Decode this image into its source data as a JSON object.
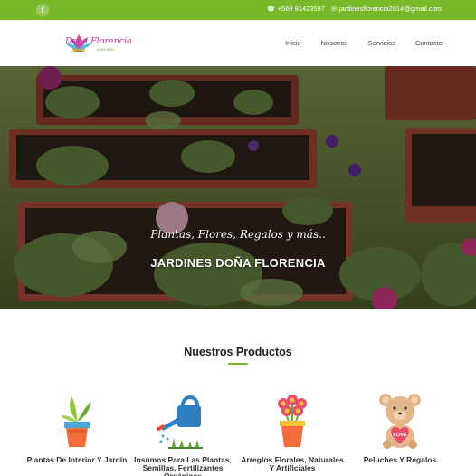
{
  "topbar": {
    "facebook_icon": "f",
    "phone": "+569 91423597",
    "email": "jardinesflorencia2014@gmail.com"
  },
  "header": {
    "logo_text": "Doña Florencia",
    "logo_subtext": "JARDINES",
    "nav": [
      "Inicio",
      "Nosotros",
      "Servicios",
      "Contacto"
    ]
  },
  "hero": {
    "tagline": "Plantas, Flores, Regalos y más..",
    "title": "JARDINES DOÑA FLORENCIA"
  },
  "products": {
    "title": "Nuestros Productos",
    "accent": "#79b829",
    "items": [
      {
        "label": "Plantas De Interior Y Jardín",
        "icon": "potted-plant-icon"
      },
      {
        "label": "Insumos Para Las Plantas, Semillas, Fertilizantes Orgánicos",
        "icon": "watering-can-icon"
      },
      {
        "label": "Arreglos Florales, Naturales Y Artificiales",
        "icon": "flower-pot-icon"
      },
      {
        "label": "Peluches Y Regalos",
        "icon": "teddy-bear-icon"
      }
    ]
  }
}
